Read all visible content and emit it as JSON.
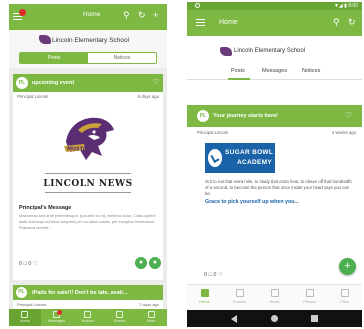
{
  "colors": {
    "brand_green": "#7db843",
    "fab_green": "#4caf50",
    "notify_red": "#e02a2a",
    "link_blue": "#1a63a8"
  },
  "left": {
    "app_title": "Home",
    "school_name": "Lincoln Elementary School",
    "segments": [
      "Posts",
      "Notices"
    ],
    "card1": {
      "avatar": "PL",
      "title": "upcoming event",
      "author": "Principal Lincoln",
      "time": "6 days ago",
      "news_title": "LINCOLN NEWS",
      "message_title": "Principal's Message",
      "message_body": "Maecenas sed ante pellentesque, posuere leo id, eleifend dolor. Class aptent taciti sociosqu ad litora torquent per conubia nostra, per inceptos himenaeos. Praesent laoreet...",
      "counts": "0 □ 0 ♡"
    },
    "card2": {
      "avatar": "PL",
      "title": "iPads for sale!!! Don't be late, avail...",
      "author": "Principal Lincoln",
      "time": "2 days ago"
    },
    "nav": [
      "Home",
      "Messages",
      "Notices",
      "Events",
      "More"
    ]
  },
  "right": {
    "status_right": "▼◢ ▮ 8:00",
    "app_title": "Home",
    "school_name": "Lincoln Elementary School",
    "tabs": [
      "Posts",
      "Messages",
      "Notices"
    ],
    "card": {
      "avatar": "PL",
      "title": "Your journey starts here!",
      "author": "Principal Lincoln",
      "time": "4 weeks ago",
      "sugar_line1": "SUGAR BOWL",
      "sugar_line2": "ACADEMY",
      "body": "Grit to run that extra mile, to study that extra hour, to shave off that hundredth of a second, to become the person that once inside your head says you can be.",
      "link": "Grace to pick yourself up when you...",
      "counts": "0 □ 0 ♡"
    },
    "fab": "+",
    "nav": [
      "Home",
      "Events",
      "News",
      "Photos",
      "Files"
    ]
  },
  "icons": {
    "menu": "menu-icon",
    "search": "search-icon",
    "refresh": "refresh-icon",
    "add": "add-icon",
    "heart": "heart-icon"
  }
}
